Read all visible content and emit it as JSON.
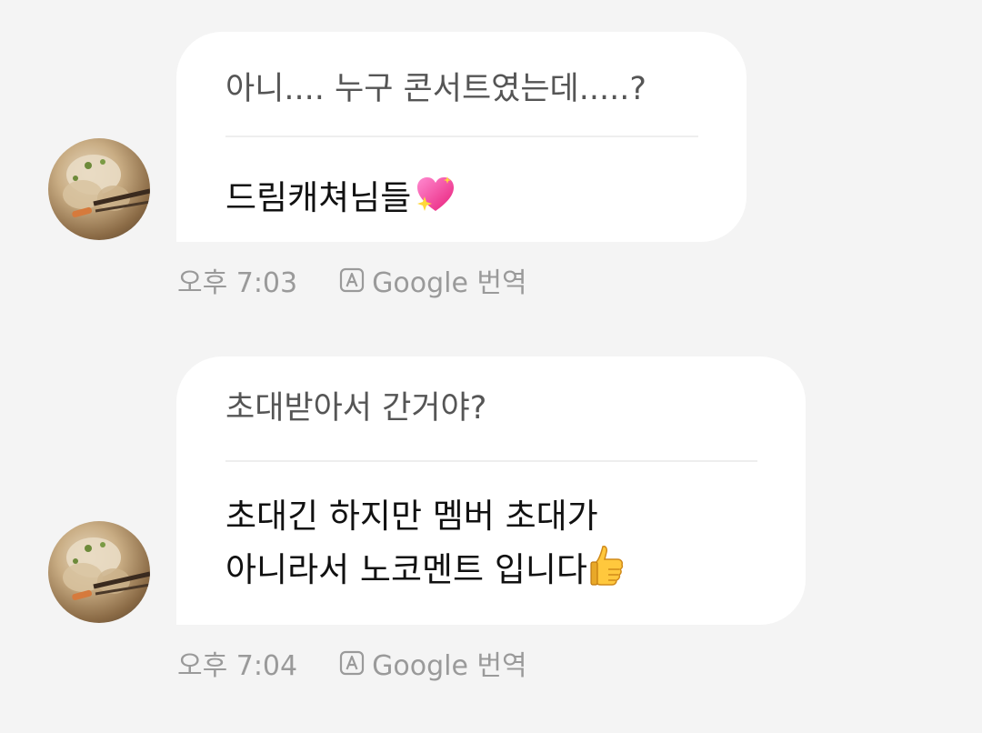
{
  "messages": [
    {
      "quoted_text": "아니.... 누구 콘서트였는데.....?",
      "reply_text": "드림캐쳐님들",
      "reply_emoji": "sparkling-heart",
      "time": "오후 7:03",
      "translate_label": "Google 번역"
    },
    {
      "quoted_text": "초대받아서 간거야?",
      "reply_lines": [
        "초대긴 하지만 멤버 초대가",
        "아니라서 노코멘트 입니다"
      ],
      "reply_emoji": "thumbs-up",
      "time": "오후 7:04",
      "translate_label": "Google 번역"
    }
  ],
  "colors": {
    "background": "#f4f4f4",
    "bubble": "#ffffff",
    "quote_text": "#555555",
    "reply_text": "#111111",
    "meta_text": "#9a9a9a"
  }
}
